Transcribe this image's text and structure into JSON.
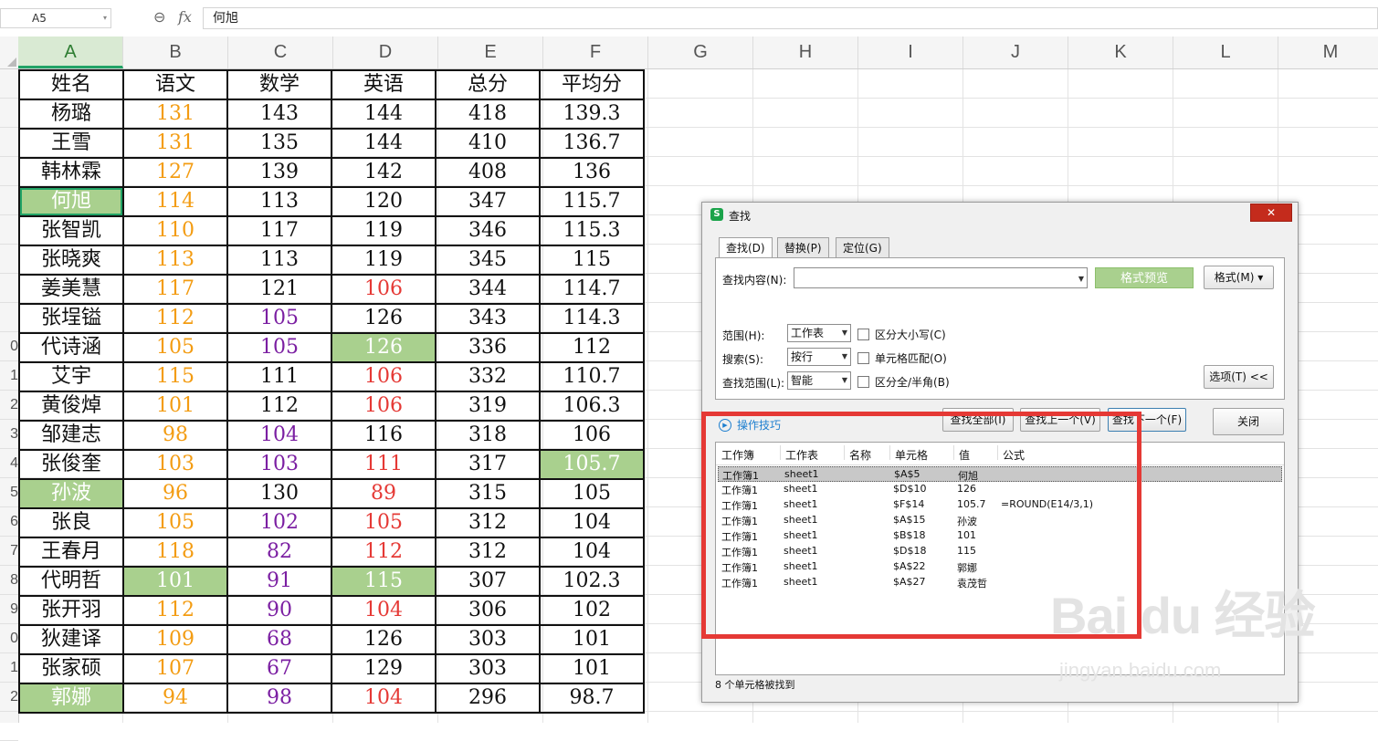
{
  "formula_bar": {
    "name_box": "A5",
    "formula": "何旭"
  },
  "columns": [
    "A",
    "B",
    "C",
    "D",
    "E",
    "F",
    "G",
    "H",
    "I",
    "J",
    "K",
    "L",
    "M"
  ],
  "row_numbers": [
    "",
    "",
    "",
    "",
    "",
    "",
    "",
    "",
    "",
    "0",
    "1",
    "2",
    "3",
    "4",
    "5",
    "6",
    "7",
    "8",
    "9",
    "0",
    "1",
    "2",
    ""
  ],
  "sheet": {
    "rows": [
      [
        {
          "v": "姓名",
          "c": ""
        },
        {
          "v": "语文",
          "c": ""
        },
        {
          "v": "数学",
          "c": ""
        },
        {
          "v": "英语",
          "c": ""
        },
        {
          "v": "总分",
          "c": ""
        },
        {
          "v": "平均分",
          "c": ""
        }
      ],
      [
        {
          "v": "杨璐",
          "c": ""
        },
        {
          "v": "131",
          "c": "orange"
        },
        {
          "v": "143",
          "c": ""
        },
        {
          "v": "144",
          "c": ""
        },
        {
          "v": "418",
          "c": ""
        },
        {
          "v": "139.3",
          "c": ""
        }
      ],
      [
        {
          "v": "王雪",
          "c": ""
        },
        {
          "v": "131",
          "c": "orange"
        },
        {
          "v": "135",
          "c": ""
        },
        {
          "v": "144",
          "c": ""
        },
        {
          "v": "410",
          "c": ""
        },
        {
          "v": "136.7",
          "c": ""
        }
      ],
      [
        {
          "v": "韩林霖",
          "c": ""
        },
        {
          "v": "127",
          "c": "orange"
        },
        {
          "v": "139",
          "c": ""
        },
        {
          "v": "142",
          "c": ""
        },
        {
          "v": "408",
          "c": ""
        },
        {
          "v": "136",
          "c": ""
        }
      ],
      [
        {
          "v": "何旭",
          "c": "green sel"
        },
        {
          "v": "114",
          "c": "orange"
        },
        {
          "v": "113",
          "c": ""
        },
        {
          "v": "120",
          "c": ""
        },
        {
          "v": "347",
          "c": ""
        },
        {
          "v": "115.7",
          "c": ""
        }
      ],
      [
        {
          "v": "张智凯",
          "c": ""
        },
        {
          "v": "110",
          "c": "orange"
        },
        {
          "v": "117",
          "c": ""
        },
        {
          "v": "119",
          "c": ""
        },
        {
          "v": "346",
          "c": ""
        },
        {
          "v": "115.3",
          "c": ""
        }
      ],
      [
        {
          "v": "张晓爽",
          "c": ""
        },
        {
          "v": "113",
          "c": "orange"
        },
        {
          "v": "113",
          "c": ""
        },
        {
          "v": "119",
          "c": ""
        },
        {
          "v": "345",
          "c": ""
        },
        {
          "v": "115",
          "c": ""
        }
      ],
      [
        {
          "v": "姜美慧",
          "c": ""
        },
        {
          "v": "117",
          "c": "orange"
        },
        {
          "v": "121",
          "c": ""
        },
        {
          "v": "106",
          "c": "red"
        },
        {
          "v": "344",
          "c": ""
        },
        {
          "v": "114.7",
          "c": ""
        }
      ],
      [
        {
          "v": "张埕镒",
          "c": ""
        },
        {
          "v": "112",
          "c": "orange"
        },
        {
          "v": "105",
          "c": "purple"
        },
        {
          "v": "126",
          "c": ""
        },
        {
          "v": "343",
          "c": ""
        },
        {
          "v": "114.3",
          "c": ""
        }
      ],
      [
        {
          "v": "代诗涵",
          "c": ""
        },
        {
          "v": "105",
          "c": "orange"
        },
        {
          "v": "105",
          "c": "purple"
        },
        {
          "v": "126",
          "c": "green"
        },
        {
          "v": "336",
          "c": ""
        },
        {
          "v": "112",
          "c": ""
        }
      ],
      [
        {
          "v": "艾宇",
          "c": ""
        },
        {
          "v": "115",
          "c": "orange"
        },
        {
          "v": "111",
          "c": ""
        },
        {
          "v": "106",
          "c": "red"
        },
        {
          "v": "332",
          "c": ""
        },
        {
          "v": "110.7",
          "c": ""
        }
      ],
      [
        {
          "v": "黄俊焯",
          "c": ""
        },
        {
          "v": "101",
          "c": "orange"
        },
        {
          "v": "112",
          "c": ""
        },
        {
          "v": "106",
          "c": "red"
        },
        {
          "v": "319",
          "c": ""
        },
        {
          "v": "106.3",
          "c": ""
        }
      ],
      [
        {
          "v": "邹建志",
          "c": ""
        },
        {
          "v": "98",
          "c": "orange"
        },
        {
          "v": "104",
          "c": "purple"
        },
        {
          "v": "116",
          "c": ""
        },
        {
          "v": "318",
          "c": ""
        },
        {
          "v": "106",
          "c": ""
        }
      ],
      [
        {
          "v": "张俊奎",
          "c": ""
        },
        {
          "v": "103",
          "c": "orange"
        },
        {
          "v": "103",
          "c": "purple"
        },
        {
          "v": "111",
          "c": "red"
        },
        {
          "v": "317",
          "c": ""
        },
        {
          "v": "105.7",
          "c": "green"
        }
      ],
      [
        {
          "v": "孙波",
          "c": "green"
        },
        {
          "v": "96",
          "c": "orange"
        },
        {
          "v": "130",
          "c": ""
        },
        {
          "v": "89",
          "c": "red"
        },
        {
          "v": "315",
          "c": ""
        },
        {
          "v": "105",
          "c": ""
        }
      ],
      [
        {
          "v": "张良",
          "c": ""
        },
        {
          "v": "105",
          "c": "orange"
        },
        {
          "v": "102",
          "c": "purple"
        },
        {
          "v": "105",
          "c": "red"
        },
        {
          "v": "312",
          "c": ""
        },
        {
          "v": "104",
          "c": ""
        }
      ],
      [
        {
          "v": "王春月",
          "c": ""
        },
        {
          "v": "118",
          "c": "orange"
        },
        {
          "v": "82",
          "c": "purple"
        },
        {
          "v": "112",
          "c": "red"
        },
        {
          "v": "312",
          "c": ""
        },
        {
          "v": "104",
          "c": ""
        }
      ],
      [
        {
          "v": "代明哲",
          "c": ""
        },
        {
          "v": "101",
          "c": "green"
        },
        {
          "v": "91",
          "c": "purple"
        },
        {
          "v": "115",
          "c": "green"
        },
        {
          "v": "307",
          "c": ""
        },
        {
          "v": "102.3",
          "c": ""
        }
      ],
      [
        {
          "v": "张开羽",
          "c": ""
        },
        {
          "v": "112",
          "c": "orange"
        },
        {
          "v": "90",
          "c": "purple"
        },
        {
          "v": "104",
          "c": "red"
        },
        {
          "v": "306",
          "c": ""
        },
        {
          "v": "102",
          "c": ""
        }
      ],
      [
        {
          "v": "狄建译",
          "c": ""
        },
        {
          "v": "109",
          "c": "orange"
        },
        {
          "v": "68",
          "c": "purple"
        },
        {
          "v": "126",
          "c": ""
        },
        {
          "v": "303",
          "c": ""
        },
        {
          "v": "101",
          "c": ""
        }
      ],
      [
        {
          "v": "张家硕",
          "c": ""
        },
        {
          "v": "107",
          "c": "orange"
        },
        {
          "v": "67",
          "c": "purple"
        },
        {
          "v": "129",
          "c": ""
        },
        {
          "v": "303",
          "c": ""
        },
        {
          "v": "101",
          "c": ""
        }
      ],
      [
        {
          "v": "郭娜",
          "c": "green"
        },
        {
          "v": "94",
          "c": "orange"
        },
        {
          "v": "98",
          "c": "purple"
        },
        {
          "v": "104",
          "c": "red"
        },
        {
          "v": "296",
          "c": ""
        },
        {
          "v": "98.7",
          "c": ""
        }
      ]
    ]
  },
  "dialog": {
    "title": "查找",
    "close_label": "✕",
    "tabs": [
      "查找(D)",
      "替换(P)",
      "定位(G)"
    ],
    "find_label": "查找内容(N):",
    "find_value": "",
    "format_preview": "格式预览",
    "format_button": "格式(M)",
    "scope_label": "范围(H):",
    "scope_value": "工作表",
    "search_label": "搜索(S):",
    "search_value": "按行",
    "lookin_label": "查找范围(L):",
    "lookin_value": "智能",
    "checks": [
      "区分大小写(C)",
      "单元格匹配(O)",
      "区分全/半角(B)"
    ],
    "options_button": "选项(T) <<",
    "tips_label": "操作技巧",
    "find_all": "查找全部(I)",
    "find_prev": "查找上一个(V)",
    "find_next": "查找下一个(F)",
    "close_button": "关闭",
    "result_headers": [
      "工作簿",
      "工作表",
      "名称",
      "单元格",
      "值",
      "公式"
    ],
    "results": [
      [
        "工作簿1",
        "sheet1",
        "",
        "$A$5",
        "何旭",
        ""
      ],
      [
        "工作簿1",
        "sheet1",
        "",
        "$D$10",
        "126",
        ""
      ],
      [
        "工作簿1",
        "sheet1",
        "",
        "$F$14",
        "105.7",
        "=ROUND(E14/3,1)"
      ],
      [
        "工作簿1",
        "sheet1",
        "",
        "$A$15",
        "孙波",
        ""
      ],
      [
        "工作簿1",
        "sheet1",
        "",
        "$B$18",
        "101",
        ""
      ],
      [
        "工作簿1",
        "sheet1",
        "",
        "$D$18",
        "115",
        ""
      ],
      [
        "工作簿1",
        "sheet1",
        "",
        "$A$22",
        "郭娜",
        ""
      ],
      [
        "工作簿1",
        "sheet1",
        "",
        "$A$27",
        "袁茂哲",
        ""
      ]
    ],
    "status": "8 个单元格被找到"
  },
  "watermark": {
    "main": "Bai du 经验",
    "sub": "jingyan.baidu.com"
  }
}
